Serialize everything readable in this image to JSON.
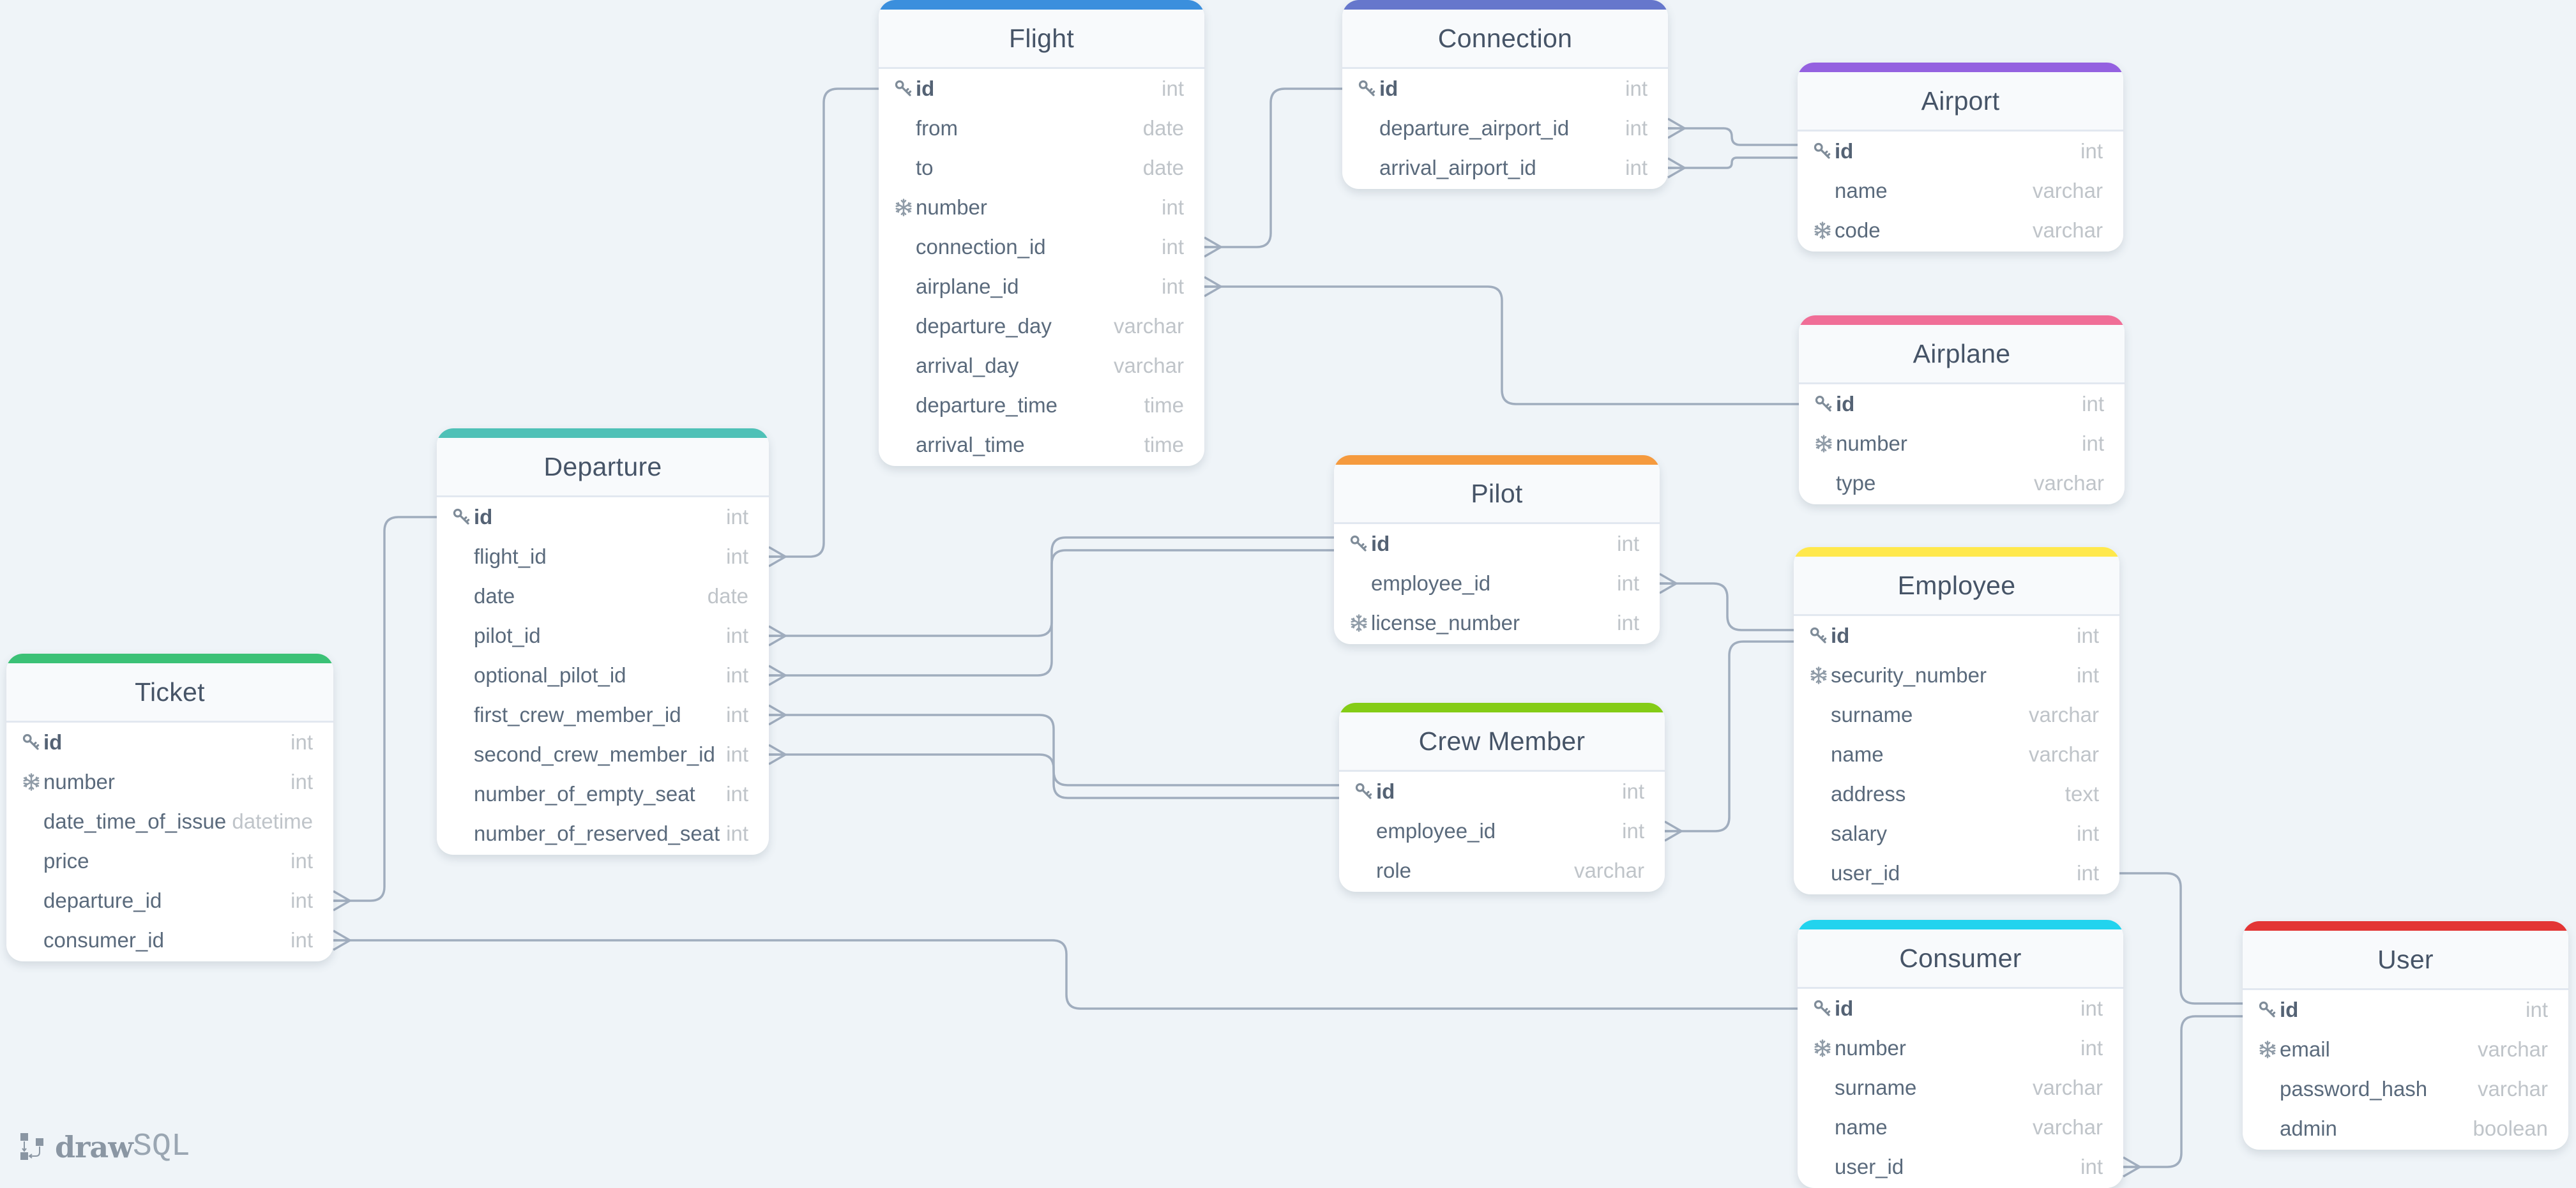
{
  "app": {
    "logo_bold": "draw",
    "logo_light": "SQL"
  },
  "colors": {
    "flight": "#3b8fdd",
    "connection": "#6677cc",
    "airport": "#9461e0",
    "airplane": "#f06e97",
    "departure": "#4fc1b7",
    "pilot": "#f59a3e",
    "employee": "#ffe84c",
    "crew_member": "#84cc16",
    "ticket": "#3bc176",
    "consumer": "#22d3ee",
    "user": "#e33535",
    "link": "#a0adbe"
  },
  "tables": {
    "flight": {
      "title": "Flight",
      "columns": [
        {
          "name": "id",
          "type": "int",
          "key": "primary"
        },
        {
          "name": "from",
          "type": "date",
          "key": ""
        },
        {
          "name": "to",
          "type": "date",
          "key": ""
        },
        {
          "name": "number",
          "type": "int",
          "key": "unique"
        },
        {
          "name": "connection_id",
          "type": "int",
          "key": ""
        },
        {
          "name": "airplane_id",
          "type": "int",
          "key": ""
        },
        {
          "name": "departure_day",
          "type": "varchar",
          "key": ""
        },
        {
          "name": "arrival_day",
          "type": "varchar",
          "key": ""
        },
        {
          "name": "departure_time",
          "type": "time",
          "key": ""
        },
        {
          "name": "arrival_time",
          "type": "time",
          "key": ""
        }
      ]
    },
    "connection": {
      "title": "Connection",
      "columns": [
        {
          "name": "id",
          "type": "int",
          "key": "primary"
        },
        {
          "name": "departure_airport_id",
          "type": "int",
          "key": ""
        },
        {
          "name": "arrival_airport_id",
          "type": "int",
          "key": ""
        }
      ]
    },
    "airport": {
      "title": "Airport",
      "columns": [
        {
          "name": "id",
          "type": "int",
          "key": "primary"
        },
        {
          "name": "name",
          "type": "varchar",
          "key": ""
        },
        {
          "name": "code",
          "type": "varchar",
          "key": "unique"
        }
      ]
    },
    "airplane": {
      "title": "Airplane",
      "columns": [
        {
          "name": "id",
          "type": "int",
          "key": "primary"
        },
        {
          "name": "number",
          "type": "int",
          "key": "unique"
        },
        {
          "name": "type",
          "type": "varchar",
          "key": ""
        }
      ]
    },
    "departure": {
      "title": "Departure",
      "columns": [
        {
          "name": "id",
          "type": "int",
          "key": "primary"
        },
        {
          "name": "flight_id",
          "type": "int",
          "key": ""
        },
        {
          "name": "date",
          "type": "date",
          "key": ""
        },
        {
          "name": "pilot_id",
          "type": "int",
          "key": ""
        },
        {
          "name": "optional_pilot_id",
          "type": "int",
          "key": ""
        },
        {
          "name": "first_crew_member_id",
          "type": "int",
          "key": ""
        },
        {
          "name": "second_crew_member_id",
          "type": "int",
          "key": ""
        },
        {
          "name": "number_of_empty_seat",
          "type": "int",
          "key": ""
        },
        {
          "name": "number_of_reserved_seat",
          "type": "int",
          "key": ""
        }
      ]
    },
    "pilot": {
      "title": "Pilot",
      "columns": [
        {
          "name": "id",
          "type": "int",
          "key": "primary"
        },
        {
          "name": "employee_id",
          "type": "int",
          "key": ""
        },
        {
          "name": "license_number",
          "type": "int",
          "key": "unique"
        }
      ]
    },
    "employee": {
      "title": "Employee",
      "columns": [
        {
          "name": "id",
          "type": "int",
          "key": "primary"
        },
        {
          "name": "security_number",
          "type": "int",
          "key": "unique"
        },
        {
          "name": "surname",
          "type": "varchar",
          "key": ""
        },
        {
          "name": "name",
          "type": "varchar",
          "key": ""
        },
        {
          "name": "address",
          "type": "text",
          "key": ""
        },
        {
          "name": "salary",
          "type": "int",
          "key": ""
        },
        {
          "name": "user_id",
          "type": "int",
          "key": ""
        }
      ]
    },
    "crew_member": {
      "title": "Crew Member",
      "columns": [
        {
          "name": "id",
          "type": "int",
          "key": "primary"
        },
        {
          "name": "employee_id",
          "type": "int",
          "key": ""
        },
        {
          "name": "role",
          "type": "varchar",
          "key": ""
        }
      ]
    },
    "ticket": {
      "title": "Ticket",
      "columns": [
        {
          "name": "id",
          "type": "int",
          "key": "primary"
        },
        {
          "name": "number",
          "type": "int",
          "key": "unique"
        },
        {
          "name": "date_time_of_issue",
          "type": "datetime",
          "key": ""
        },
        {
          "name": "price",
          "type": "int",
          "key": ""
        },
        {
          "name": "departure_id",
          "type": "int",
          "key": ""
        },
        {
          "name": "consumer_id",
          "type": "int",
          "key": ""
        }
      ]
    },
    "consumer": {
      "title": "Consumer",
      "columns": [
        {
          "name": "id",
          "type": "int",
          "key": "primary"
        },
        {
          "name": "number",
          "type": "int",
          "key": "unique"
        },
        {
          "name": "surname",
          "type": "varchar",
          "key": ""
        },
        {
          "name": "name",
          "type": "varchar",
          "key": ""
        },
        {
          "name": "user_id",
          "type": "int",
          "key": ""
        }
      ]
    },
    "user": {
      "title": "User",
      "columns": [
        {
          "name": "id",
          "type": "int",
          "key": "primary"
        },
        {
          "name": "email",
          "type": "varchar",
          "key": "unique"
        },
        {
          "name": "password_hash",
          "type": "varchar",
          "key": ""
        },
        {
          "name": "admin",
          "type": "boolean",
          "key": ""
        }
      ]
    }
  },
  "relations": [
    {
      "from": "flight.connection_id",
      "to": "connection.id",
      "cardinality": "many-to-one"
    },
    {
      "from": "flight.airplane_id",
      "to": "airplane.id",
      "cardinality": "many-to-one"
    },
    {
      "from": "connection.departure_airport_id",
      "to": "airport.id",
      "cardinality": "many-to-one"
    },
    {
      "from": "connection.arrival_airport_id",
      "to": "airport.id",
      "cardinality": "many-to-one"
    },
    {
      "from": "departure.flight_id",
      "to": "flight.id",
      "cardinality": "many-to-one"
    },
    {
      "from": "departure.pilot_id",
      "to": "pilot.id",
      "cardinality": "many-to-one"
    },
    {
      "from": "departure.optional_pilot_id",
      "to": "pilot.id",
      "cardinality": "many-to-one"
    },
    {
      "from": "departure.first_crew_member_id",
      "to": "crew_member.id",
      "cardinality": "many-to-one"
    },
    {
      "from": "departure.second_crew_member_id",
      "to": "crew_member.id",
      "cardinality": "many-to-one"
    },
    {
      "from": "pilot.employee_id",
      "to": "employee.id",
      "cardinality": "many-to-one"
    },
    {
      "from": "crew_member.employee_id",
      "to": "employee.id",
      "cardinality": "many-to-one"
    },
    {
      "from": "employee.user_id",
      "to": "user.id",
      "cardinality": "one-to-one"
    },
    {
      "from": "ticket.departure_id",
      "to": "departure.id",
      "cardinality": "many-to-one"
    },
    {
      "from": "ticket.consumer_id",
      "to": "consumer.id",
      "cardinality": "many-to-one"
    },
    {
      "from": "consumer.user_id",
      "to": "user.id",
      "cardinality": "many-to-one"
    }
  ]
}
